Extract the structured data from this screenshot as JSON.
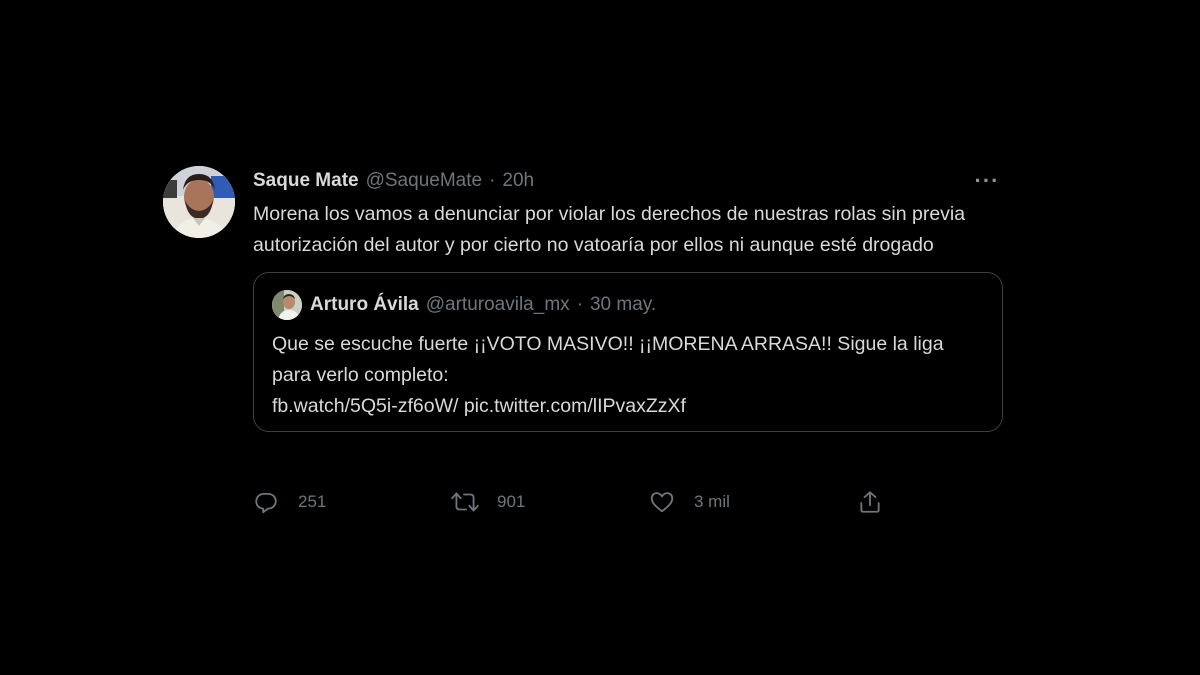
{
  "tweet": {
    "author_name": "Saque Mate",
    "author_handle": "@SaqueMate",
    "separator": "·",
    "time": "20h",
    "more_label": "···",
    "text": "Morena los vamos a denunciar por violar los derechos de nuestras rolas sin previa autorización del autor y por cierto no vatoaría por ellos ni aunque esté drogado",
    "avatar_icon": "person-photo-icon"
  },
  "quoted": {
    "author_name": "Arturo Ávila",
    "author_handle": "@arturoavila_mx",
    "separator": "·",
    "date": "30 may.",
    "text_line1": "Que se escuche fuerte ¡¡VOTO MASIVO!! ¡¡MORENA ARRASA!! Sigue la liga para verlo completo:",
    "link1": "fb.watch/5Q5i-zf6oW/",
    "link2": "pic.twitter.com/lIPvaxZzXf",
    "avatar_icon": "person-photo-icon"
  },
  "actions": {
    "replies": "251",
    "retweets": "901",
    "likes": "3 mil",
    "reply_icon": "reply-icon",
    "retweet_icon": "retweet-icon",
    "like_icon": "heart-icon",
    "share_icon": "share-icon"
  },
  "colors": {
    "background": "#000000",
    "text": "#d9d9d9",
    "secondary": "#6e767d",
    "border": "#3a3f44"
  }
}
